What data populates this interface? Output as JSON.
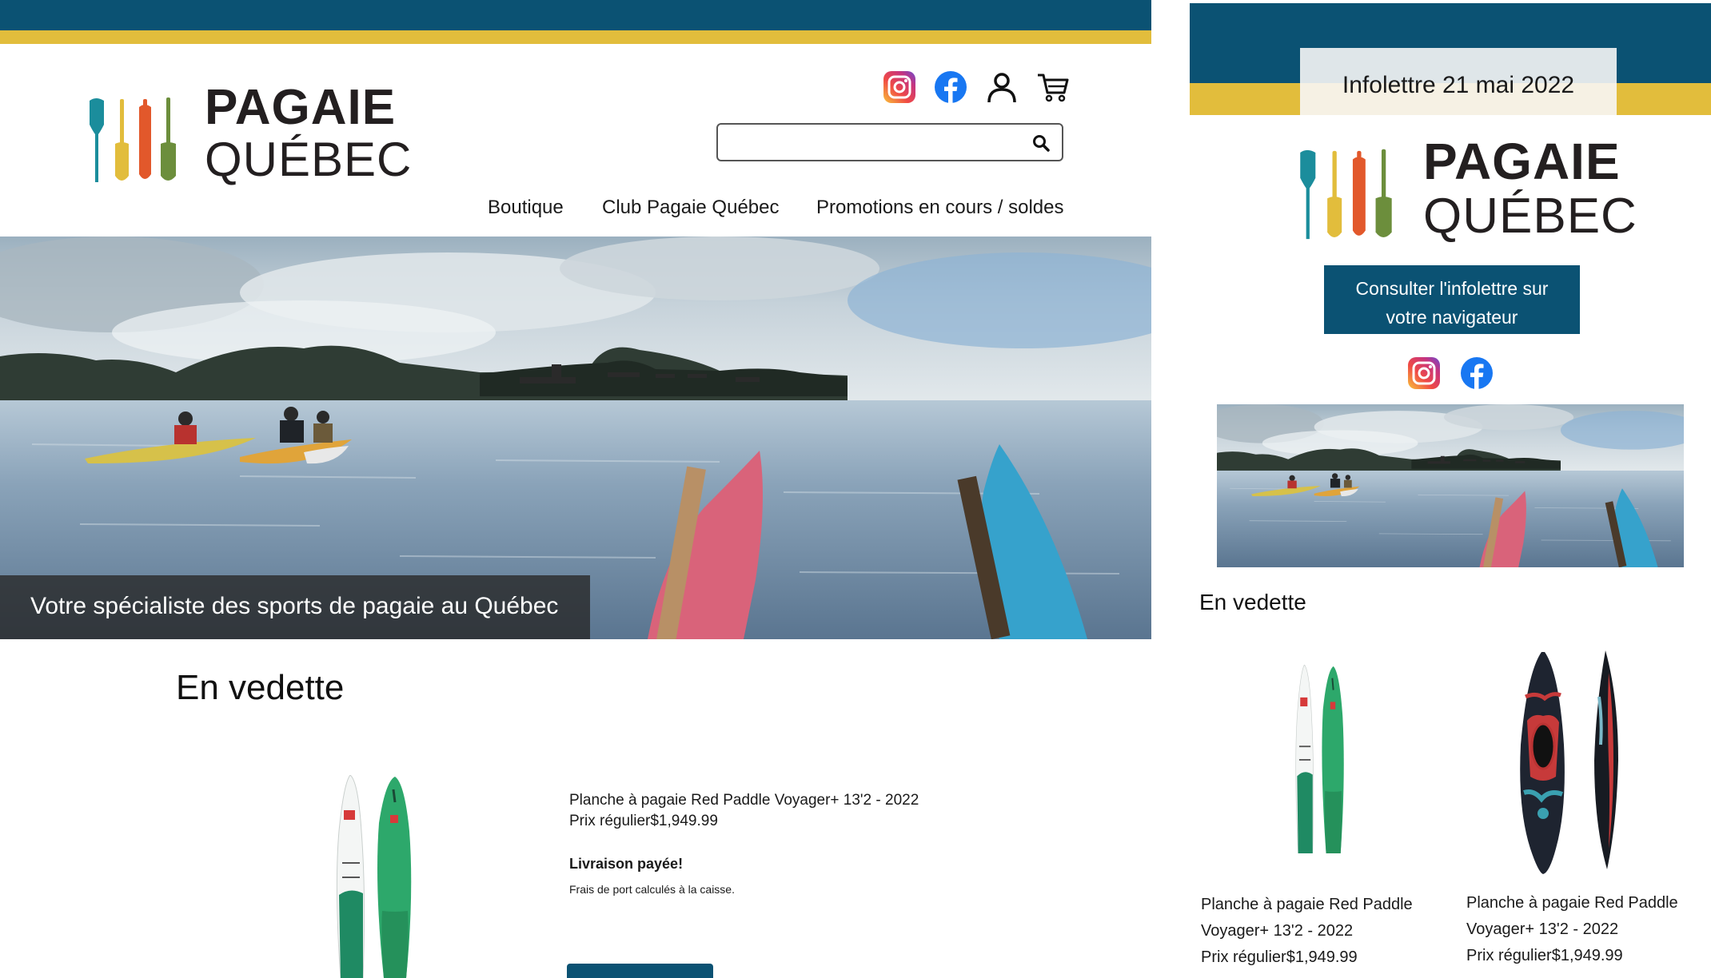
{
  "website": {
    "logo": {
      "line1": "PAGAIE",
      "line2": "QUÉBEC"
    },
    "header_icons": [
      "instagram-icon",
      "facebook-icon",
      "account-icon",
      "cart-icon"
    ],
    "search": {
      "placeholder": "",
      "value": ""
    },
    "nav": [
      "Boutique",
      "Club Pagaie Québec",
      "Promotions en cours / soldes"
    ],
    "hero_caption": "Votre spécialiste des sports de pagaie au Québec",
    "featured_title": "En vedette",
    "product": {
      "name": "Planche à pagaie Red Paddle Voyager+ 13'2 - 2022",
      "price": "Prix régulier$1,949.99",
      "shipping_title": "Livraison payée!",
      "shipping_note": "Frais de port calculés à la caisse."
    }
  },
  "newsletter": {
    "date_label": "Infolettre 21 mai 2022",
    "logo": {
      "line1": "PAGAIE",
      "line2": "QUÉBEC"
    },
    "browser_button": [
      "Consulter l'infolettre sur",
      "votre navigateur"
    ],
    "social_icons": [
      "instagram-icon",
      "facebook-icon"
    ],
    "featured_title": "En vedette",
    "products": [
      {
        "line1": "Planche à pagaie Red Paddle",
        "line2": "Voyager+ 13'2 - 2022",
        "line3": "Prix régulier$1,949.99"
      },
      {
        "line1": "Planche à pagaie Red Paddle",
        "line2": "Voyager+ 13'2 - 2022",
        "line3": "Prix régulier$1,949.99"
      }
    ]
  },
  "colors": {
    "brand_blue": "#0b5273",
    "brand_yellow": "#e2bd3c",
    "paddle_teal": "#1b8d9c",
    "paddle_yellow": "#e2bd3c",
    "paddle_orange": "#e2582b",
    "paddle_green": "#6c8e3c",
    "facebook_blue": "#1877f2"
  }
}
